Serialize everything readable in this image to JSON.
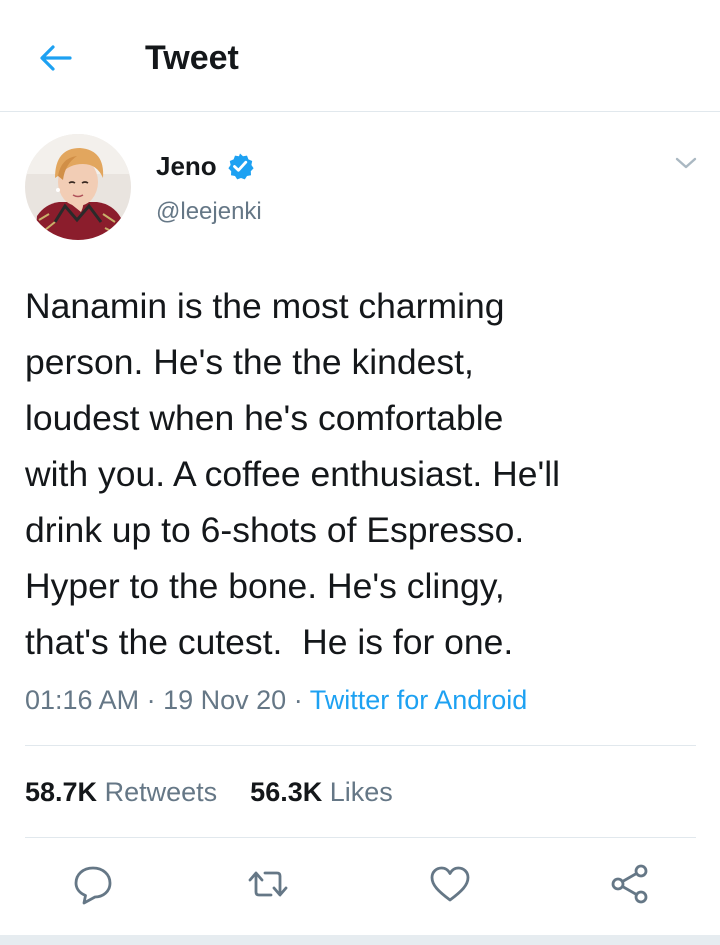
{
  "header": {
    "title": "Tweet",
    "back_icon": "arrow-left-icon"
  },
  "author": {
    "name": "Jeno",
    "handle": "@leejenki",
    "verified": true,
    "avatar": "avatar"
  },
  "tweet": {
    "lines": [
      "Nanamin is the most charming",
      "person. He's the the kindest,",
      "loudest when he's comfortable",
      "with you. A coffee enthusiast. He'll",
      "drink up to 6-shots of Espresso.",
      "Hyper to the bone. He's clingy,",
      "that's the cutest.  He is for one."
    ],
    "time": "01:16 AM",
    "date": "19 Nov 20",
    "source": "Twitter for Android"
  },
  "stats": {
    "retweets_count": "58.7K",
    "retweets_label": "Retweets",
    "likes_count": "56.3K",
    "likes_label": "Likes"
  },
  "actions": [
    "reply-icon",
    "retweet-icon",
    "like-icon",
    "share-icon"
  ],
  "colors": {
    "accent": "#1da1f2",
    "text": "#14171a",
    "secondary": "#657786",
    "divider": "#e1e8ed"
  }
}
